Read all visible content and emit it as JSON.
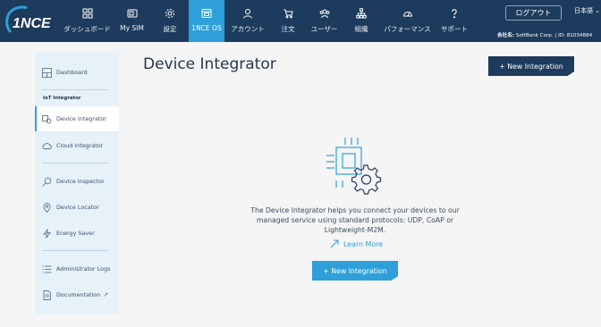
{
  "brand": {
    "logo_text": "1NCE",
    "accent": "#2e9fd8",
    "nav_bg": "#1d3b5c"
  },
  "nav": {
    "items": [
      {
        "label": "ダッシュボード",
        "icon": "grid-icon"
      },
      {
        "label": "My SIM",
        "icon": "sim-icon"
      },
      {
        "label": "設定",
        "icon": "gear-icon"
      },
      {
        "label": "1NCE OS",
        "icon": "os-icon",
        "active": true
      },
      {
        "label": "アカウント",
        "icon": "person-icon"
      },
      {
        "label": "注文",
        "icon": "cart-icon"
      },
      {
        "label": "ユーザー",
        "icon": "users-icon"
      },
      {
        "label": "組織",
        "icon": "org-icon"
      },
      {
        "label": "パフォーマンス",
        "icon": "gauge-icon"
      },
      {
        "label": "サポート",
        "icon": "help-icon"
      }
    ],
    "logout_label": "ログアウト",
    "language": "日本語",
    "company_label": "会社名:",
    "company_value": "SoftBank Corp. | ID: 81034884"
  },
  "sidebar": {
    "items": [
      {
        "label": "Dashboard",
        "icon": "dashboard-icon"
      },
      {
        "label": "Device Integrator",
        "icon": "device-integrator-icon",
        "active": true
      },
      {
        "label": "Cloud Integrator",
        "icon": "cloud-icon"
      },
      {
        "label": "Device Inspector",
        "icon": "magnifier-icon"
      },
      {
        "label": "Device Locator",
        "icon": "location-pin-icon"
      },
      {
        "label": "Energy Saver",
        "icon": "lightning-icon"
      },
      {
        "label": "Administrator Logs",
        "icon": "list-icon"
      },
      {
        "label": "Documentation",
        "icon": "document-icon"
      }
    ],
    "section_label": "IoT Integrator",
    "external_mark": "↗"
  },
  "main": {
    "title": "Device Integrator",
    "new_integration_label": "+ New Integration",
    "description": "The Device Integrator helps you connect your devices to our managed service using standard protocols: UDP, CoAP or Lightweight-M2M.",
    "learn_more_label": "Learn More",
    "illustration_icon": "chip-gear-icon"
  }
}
